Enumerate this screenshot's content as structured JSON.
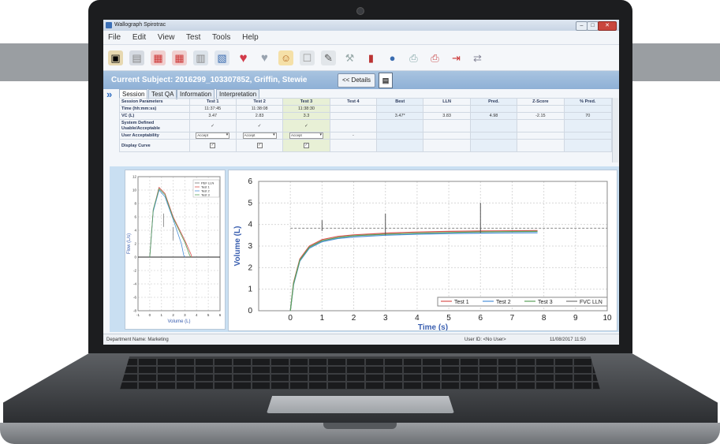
{
  "window": {
    "title": "Wallograph Spirotrac"
  },
  "menu": [
    "File",
    "Edit",
    "View",
    "Test",
    "Tools",
    "Help"
  ],
  "subject": {
    "label": "Current Subject: 2016299_103307852, Griffin, Stewie",
    "details_button": "<< Details"
  },
  "tabs": [
    "Session",
    "Test QA",
    "Information",
    "Interpretation"
  ],
  "table": {
    "headers": [
      "Session Parameters",
      "Test 1",
      "Test 2",
      "Test 3",
      "Test 4",
      "Best",
      "LLN",
      "Pred.",
      "Z-Score",
      "% Pred."
    ],
    "rows": [
      {
        "label": "Time (hh:mm:ss)",
        "cells": [
          "11:37:45",
          "11:38:08",
          "11:38:30",
          "",
          "",
          "",
          "",
          "",
          ""
        ]
      },
      {
        "label": "VC (L)",
        "cells": [
          "3.47",
          "2.83",
          "3.3",
          "",
          "3.47*",
          "3.83",
          "4.98",
          "-2.15",
          "70"
        ]
      },
      {
        "label": "System Defined Usable/Acceptable",
        "cells": [
          "✓",
          "✓",
          "✓",
          "",
          "",
          "",
          "",
          "",
          ""
        ]
      },
      {
        "label": "User Acceptability",
        "cells": [
          "Accept",
          "Accept",
          "Accept",
          "-",
          "",
          "",
          "",
          "",
          ""
        ]
      },
      {
        "label": "Display Curve",
        "cells": [
          "✓",
          "✓",
          "✓",
          "",
          "",
          "",
          "",
          "",
          ""
        ]
      }
    ]
  },
  "fv_chart": {
    "xlabel": "Volume (L)",
    "ylabel": "Flow (L/s)",
    "x_ticks": [
      "-1",
      "0",
      "1",
      "2",
      "3",
      "4",
      "5",
      "6"
    ],
    "y_ticks": [
      "12",
      "10",
      "8",
      "6",
      "4",
      "2",
      "0",
      "-2",
      "-4",
      "-6",
      "-8"
    ],
    "legend": [
      "PEF LLN",
      "Test 1",
      "Test 2",
      "Test 3"
    ]
  },
  "chart_data": {
    "type": "line",
    "title": "",
    "xlabel": "Time (s)",
    "ylabel": "Volume (L)",
    "xlim": [
      -1,
      10
    ],
    "ylim": [
      0,
      6
    ],
    "x_ticks": [
      "0",
      "1",
      "2",
      "3",
      "4",
      "5",
      "6",
      "7",
      "8",
      "9",
      "10"
    ],
    "y_ticks": [
      "0",
      "1",
      "2",
      "3",
      "4",
      "5",
      "6"
    ],
    "reference_line": 3.83,
    "series": [
      {
        "name": "Test 1",
        "color": "#d9534f",
        "x": [
          0,
          0.1,
          0.3,
          0.6,
          1,
          1.5,
          2,
          3,
          4,
          5,
          6,
          7.8
        ],
        "y": [
          0,
          1.3,
          2.4,
          3.0,
          3.3,
          3.45,
          3.52,
          3.6,
          3.65,
          3.68,
          3.7,
          3.72
        ]
      },
      {
        "name": "Test 2",
        "color": "#4a90d9",
        "x": [
          0,
          0.1,
          0.3,
          0.6,
          1,
          1.5,
          2,
          3,
          4,
          5,
          6,
          7.8
        ],
        "y": [
          0,
          1.2,
          2.3,
          2.9,
          3.2,
          3.35,
          3.42,
          3.5,
          3.55,
          3.58,
          3.6,
          3.62
        ]
      },
      {
        "name": "Test 3",
        "color": "#5aa05a",
        "x": [
          0,
          0.1,
          0.3,
          0.6,
          1,
          1.5,
          2,
          3,
          4,
          5,
          6,
          7.8
        ],
        "y": [
          0,
          1.25,
          2.35,
          2.95,
          3.25,
          3.4,
          3.48,
          3.55,
          3.6,
          3.63,
          3.66,
          3.68
        ]
      },
      {
        "name": "FVC LLN",
        "color": "#777777",
        "x": [
          0,
          10
        ],
        "y": [
          3.83,
          3.83
        ]
      }
    ],
    "legend": [
      "Test 1",
      "Test 2",
      "Test 3",
      "FVC LLN"
    ]
  },
  "status": {
    "department": "Department Name: Marketing",
    "user": "User ID: <No User>",
    "datetime": "11/08/2017 11:50"
  }
}
